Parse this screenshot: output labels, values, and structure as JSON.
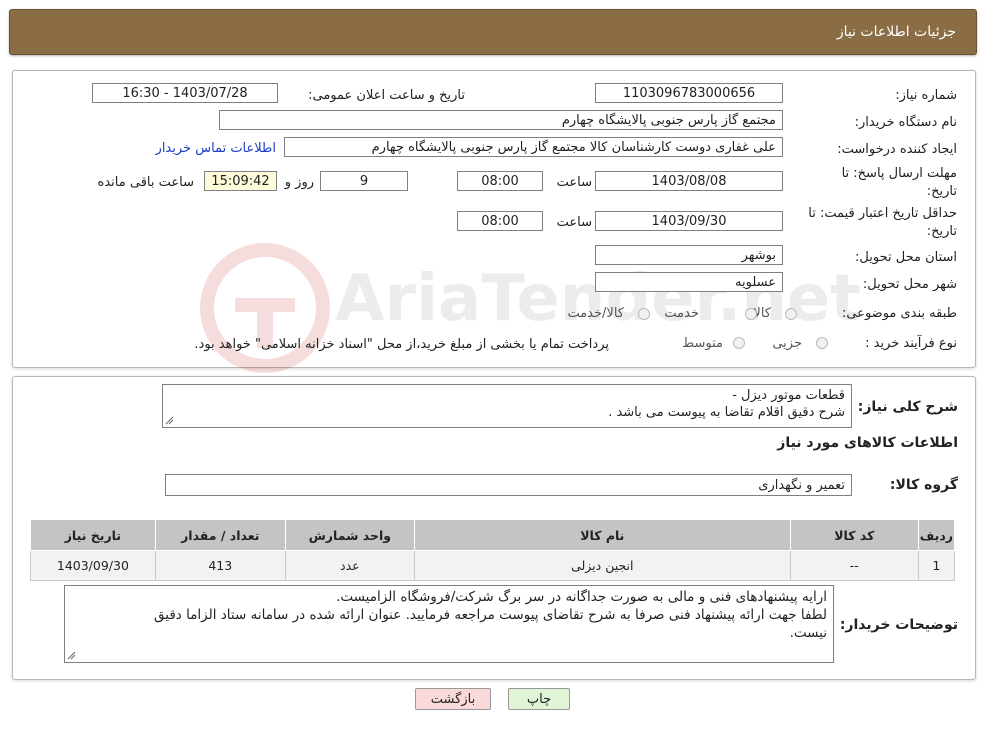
{
  "page_title": "جزئیات اطلاعات نیاز",
  "fields": {
    "need_number_label": "شماره نیاز:",
    "need_number": "1103096783000656",
    "announce_label": "تاریخ و ساعت اعلان عمومی:",
    "announce_value": "1403/07/28 - 16:30",
    "buyer_org_label": "نام دستگاه خریدار:",
    "buyer_org": "مجتمع گاز پارس جنوبی  پالایشگاه چهارم",
    "requester_label": "ایجاد کننده درخواست:",
    "requester": "علی غفاری دوست کارشناسان کالا مجتمع گاز پارس جنوبی  پالایشگاه چهارم",
    "contact_link": "اطلاعات تماس خریدار",
    "deadline_label_1": "مهلت ارسال پاسخ: تا",
    "deadline_label_2": "تاریخ:",
    "deadline_date": "1403/08/08",
    "time_label": "ساعت",
    "deadline_time": "08:00",
    "days_value": "9",
    "days_label": "روز و",
    "remaining_time": "15:09:42",
    "remaining_label": "ساعت باقی مانده",
    "validity_label_1": "حداقل تاریخ اعتبار قیمت: تا",
    "validity_label_2": "تاریخ:",
    "validity_date": "1403/09/30",
    "validity_time": "08:00",
    "province_label": "استان محل تحویل:",
    "province": "بوشهر",
    "city_label": "شهر محل تحویل:",
    "city": "عسلویه",
    "category_label": "طبقه بندی موضوعی:",
    "category_options": [
      "کالا",
      "خدمت",
      "کالا/خدمت"
    ],
    "process_label": "نوع فرآیند خرید :",
    "process_options": [
      "جزیی",
      "متوسط"
    ],
    "process_note": "پرداخت تمام یا بخشی از مبلغ خرید،از محل \"اسناد خزانه اسلامی\" خواهد بود."
  },
  "summary": {
    "label": "شرح کلی نیاز:",
    "line1": "قطعات موتور دیزل  -",
    "line2": "شرح دقیق اقلام تقاضا به پیوست می باشد ."
  },
  "goods_section_title": "اطلاعات کالاهای مورد نیاز",
  "goods_group_label": "گروه کالا:",
  "goods_group": "تعمیر و نگهداری",
  "table": {
    "headers": [
      "ردیف",
      "کد کالا",
      "نام کالا",
      "واحد شمارش",
      "تعداد / مقدار",
      "تاریخ نیاز"
    ],
    "rows": [
      [
        "1",
        "--",
        "انجین دیزلی",
        "عدد",
        "413",
        "1403/09/30"
      ]
    ]
  },
  "buyer_notes": {
    "label": "توضیحات خریدار:",
    "line1": "ارایه پیشنهادهای فنی و مالی به صورت جداگانه در سر برگ شرکت/فروشگاه الزامیست.",
    "line2": "لطفا جهت ارائه پیشنهاد فنی صرفا به شرح تقاضای پیوست مراجعه فرمایید. عنوان ارائه شده در سامانه ستاد الزاما دقیق",
    "line3": "نیست."
  },
  "buttons": {
    "print": "چاپ",
    "back": "بازگشت"
  },
  "watermark": "AriaTender.net",
  "colors": {
    "header_bg": "#8a6d45",
    "link": "#1a3cc8",
    "back_btn_bg": "#f9d9d9",
    "print_btn_bg": "#dff5d6",
    "remaining_bg": "#fdfbd9"
  }
}
